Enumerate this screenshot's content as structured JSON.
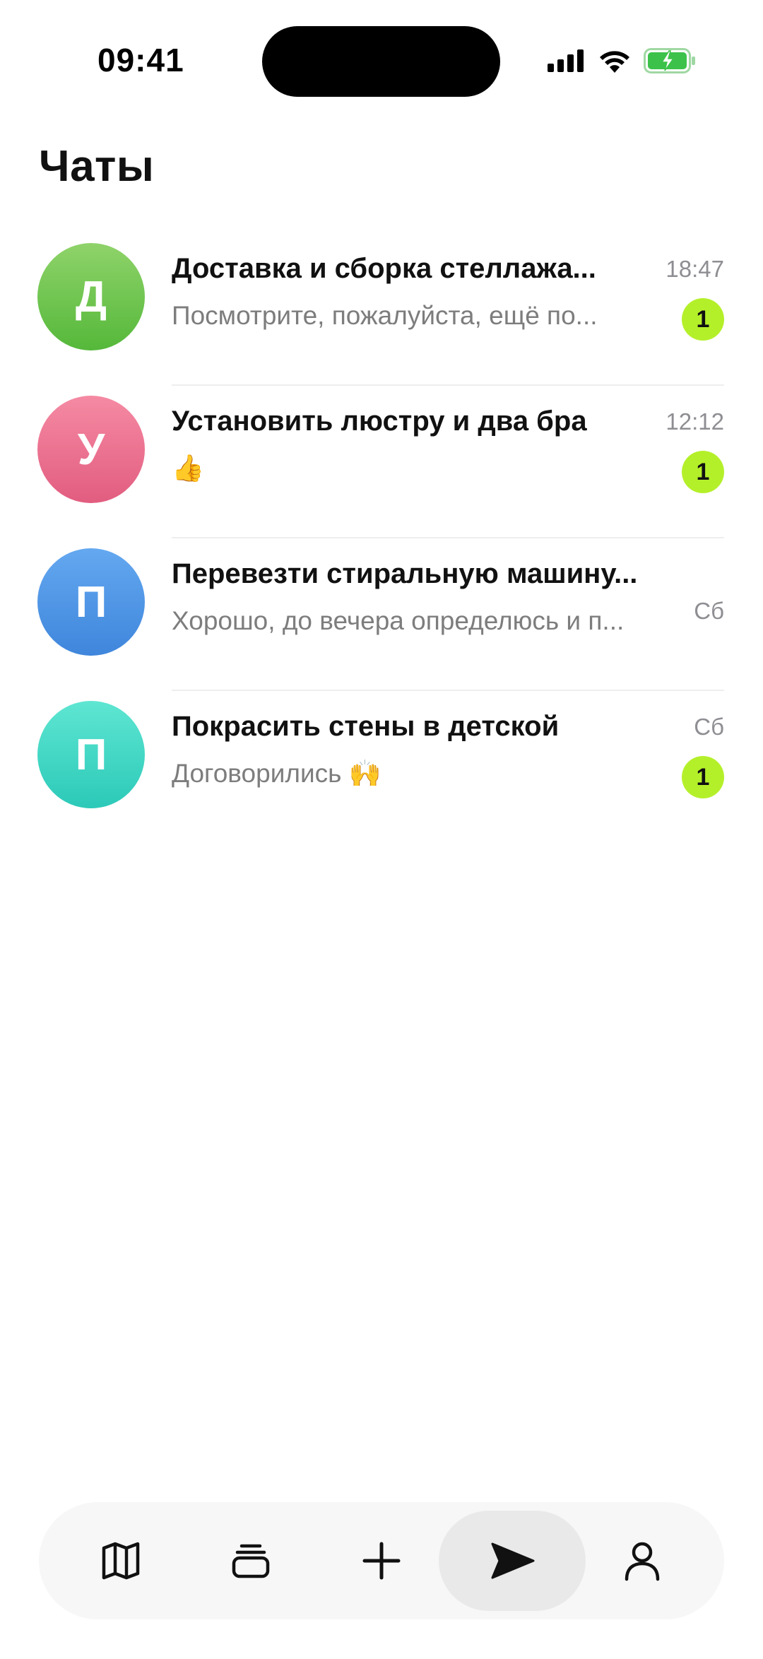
{
  "status_bar": {
    "time": "09:41"
  },
  "title": "Чаты",
  "colors": {
    "badge": "#b4f02a",
    "avatar_green": "#67c24a",
    "avatar_pink": "#ea6f8c",
    "avatar_blue": "#4a90e2",
    "avatar_teal": "#3cd6c4"
  },
  "chats": [
    {
      "initial": "Д",
      "title": "Доставка и сборка стеллажа...",
      "preview": "Посмотрите, пожалуйста, ещё по...",
      "time": "18:47",
      "unread": "1"
    },
    {
      "initial": "У",
      "title": "Установить люстру и два бра",
      "preview": "👍",
      "time": "12:12",
      "unread": "1"
    },
    {
      "initial": "П",
      "title": "Перевезти стиральную машину...",
      "preview": "Хорошо, до вечера определюсь и п...",
      "time": "Сб"
    },
    {
      "initial": "П",
      "title": "Покрасить стены в детской",
      "preview": "Договорились 🙌",
      "time": "Сб",
      "unread": "1"
    }
  ],
  "nav": {
    "items": [
      "map-icon",
      "stack-icon",
      "plus-icon",
      "send-icon",
      "profile-icon"
    ],
    "active": "send-icon"
  }
}
